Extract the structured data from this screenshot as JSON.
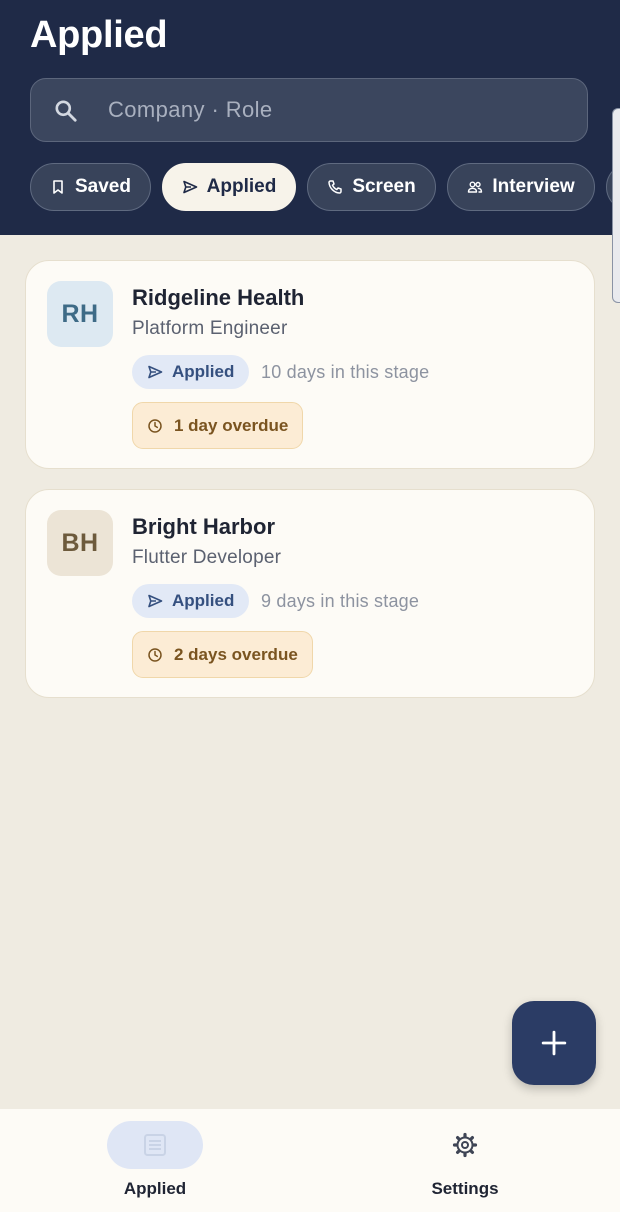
{
  "header": {
    "title": "Applied",
    "search_placeholder": "Company · Role",
    "chips": [
      {
        "label": "Saved",
        "icon": "bookmark-icon",
        "active": false
      },
      {
        "label": "Applied",
        "icon": "send-icon",
        "active": true
      },
      {
        "label": "Screen",
        "icon": "phone-icon",
        "active": false
      },
      {
        "label": "Interview",
        "icon": "people-icon",
        "active": false
      }
    ]
  },
  "cards": [
    {
      "initials": "RH",
      "company": "Ridgeline Health",
      "role": "Platform Engineer",
      "stage": "Applied",
      "days": "10 days in this stage",
      "overdue": "1 day overdue",
      "avatar_bg": "#dde9f2",
      "avatar_fg": "#3e6b87"
    },
    {
      "initials": "BH",
      "company": "Bright Harbor",
      "role": "Flutter Developer",
      "stage": "Applied",
      "days": "9 days in this stage",
      "overdue": "2 days overdue",
      "avatar_bg": "#ece4d6",
      "avatar_fg": "#6d5a3c"
    }
  ],
  "fab": {
    "icon": "plus-icon"
  },
  "nav": {
    "items": [
      {
        "label": "Applied",
        "icon": "list-icon",
        "active": true
      },
      {
        "label": "Settings",
        "icon": "gear-icon",
        "active": false
      }
    ]
  },
  "colors": {
    "header_bg": "#1f2a47",
    "page_bg": "#efebe1",
    "accent": "#2b3c65",
    "badge_bg": "#e2e9f6",
    "overdue_bg": "#fcecd5"
  }
}
